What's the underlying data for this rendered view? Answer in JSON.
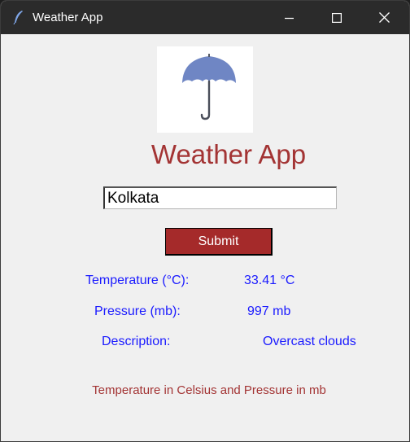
{
  "window": {
    "title": "Weather App",
    "app_icon": "feather-icon",
    "controls": [
      "minimize-icon",
      "maximize-icon",
      "close-icon"
    ]
  },
  "logo": {
    "icon": "umbrella-icon"
  },
  "heading": "Weather App",
  "search": {
    "value": "Kolkata"
  },
  "submit_label": "Submit",
  "results": {
    "temperature": {
      "label": "Temperature (°C):",
      "value": "33.41 °C"
    },
    "pressure": {
      "label": "Pressure (mb):",
      "value": "997 mb"
    },
    "description": {
      "label": "Description:",
      "value": "Overcast clouds"
    }
  },
  "footer": "Temperature in Celsius and Pressure in mb",
  "colors": {
    "heading": "#a33434",
    "labels": "#1a1aff",
    "button": "#a52a2a",
    "titlebar": "#2b2b2b",
    "umbrella": "#6f86c4"
  }
}
